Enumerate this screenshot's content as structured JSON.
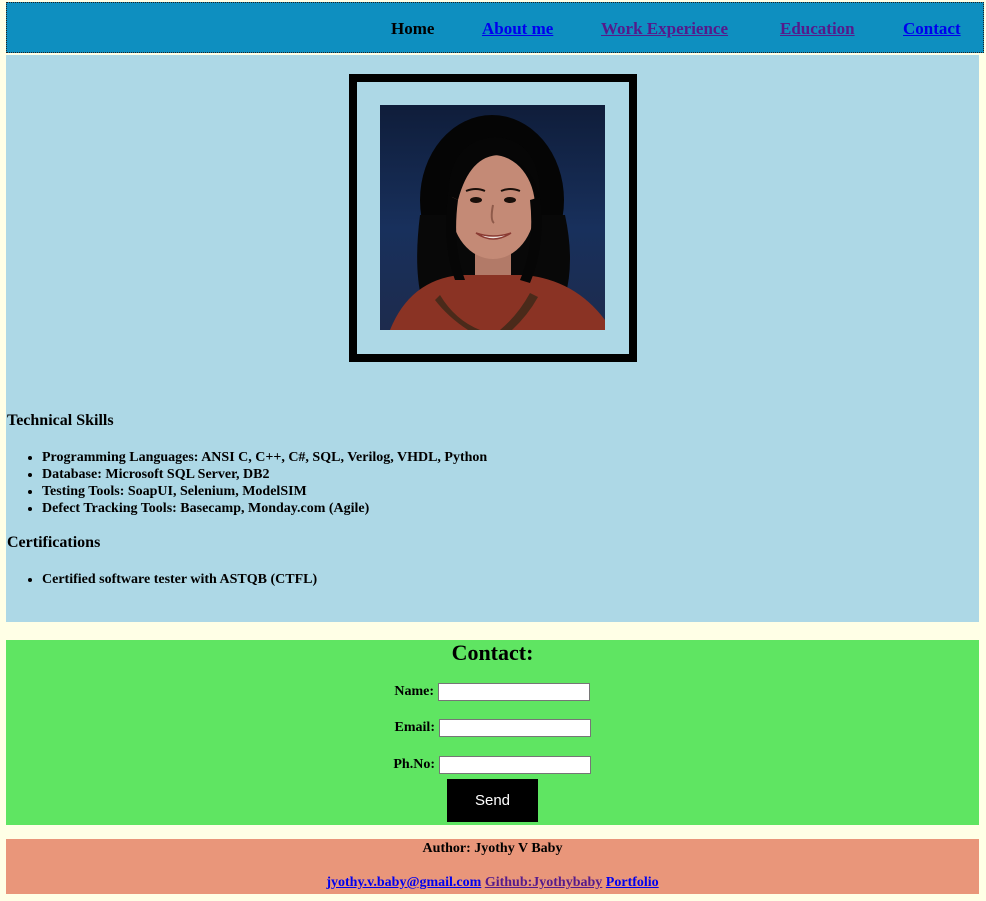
{
  "nav": {
    "home": "Home",
    "about": "About me",
    "work": "Work Experience",
    "education": "Education",
    "contact": "Contact"
  },
  "profile": {
    "photo_alt": "profile-photo"
  },
  "skills": {
    "title": "Technical Skills",
    "items": [
      "Programming Languages: ANSI C, C++, C#, SQL, Verilog, VHDL, Python",
      "Database: Microsoft SQL Server, DB2",
      "Testing Tools: SoapUI, Selenium, ModelSIM",
      "Defect Tracking Tools: Basecamp, Monday.com (Agile)"
    ]
  },
  "certifications": {
    "title": "Certifications",
    "items": [
      "Certified software tester with ASTQB (CTFL)"
    ]
  },
  "contact_form": {
    "title": "Contact:",
    "name_label": "Name:",
    "email_label": "Email:",
    "phone_label": "Ph.No:",
    "name_value": "",
    "email_value": "",
    "phone_value": "",
    "send_label": "Send"
  },
  "footer": {
    "author": "Author: Jyothy V Baby",
    "email_link": "jyothy.v.baby@gmail.com",
    "github_link": "Github:Jyothybaby",
    "portfolio_link": "Portfolio"
  },
  "colors": {
    "nav_bg": "#0e8fc0",
    "main_bg": "#add8e6",
    "contact_bg": "#5fe562",
    "footer_bg": "#e9967a",
    "page_bg": "#ffffe6"
  }
}
